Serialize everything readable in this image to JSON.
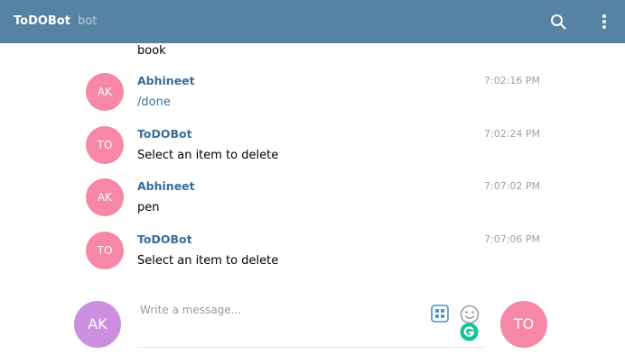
{
  "header": {
    "title": "ToDOBot",
    "subtitle": "bot",
    "search_icon": "search-icon",
    "menu_icon": "more-vertical-icon",
    "background": "#5682a3"
  },
  "messages": {
    "partial_text": "book",
    "items": [
      {
        "initials": "AK",
        "sender": "Abhineet",
        "time": "7:02:16 PM",
        "text": "/done"
      },
      {
        "initials": "TO",
        "sender": "ToDOBot",
        "time": "7:02:24 PM",
        "text": "Select an item to delete"
      },
      {
        "initials": "AK",
        "sender": "Abhineet",
        "time": "7:07:02 PM",
        "text": "pen"
      },
      {
        "initials": "TO",
        "sender": "ToDOBot",
        "time": "7:07:06 PM",
        "text": "Select an item to delete"
      }
    ],
    "avatar_color": "#f687a6",
    "sender_color": "#3a6d99"
  },
  "composer": {
    "my_initials": "AK",
    "my_avatar_color": "#cc8fe0",
    "placeholder": "Write a message...",
    "commands_icon": "commands-icon",
    "emoji_icon": "emoji-icon",
    "grammarly_icon": "grammarly-icon",
    "peer_initials": "TO"
  }
}
